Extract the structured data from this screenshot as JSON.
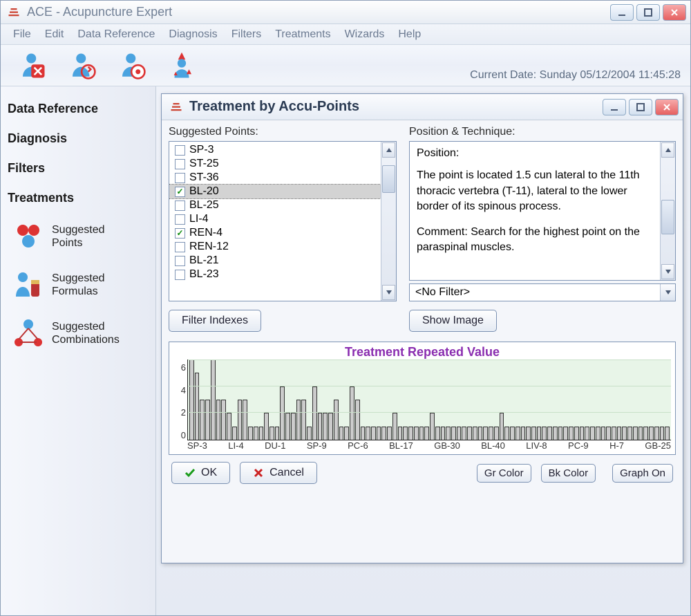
{
  "window": {
    "title": "ACE - Acupuncture Expert"
  },
  "menu": {
    "items": [
      "File",
      "Edit",
      "Data Reference",
      "Diagnosis",
      "Filters",
      "Treatments",
      "Wizards",
      "Help"
    ]
  },
  "status": {
    "current_date_label": "Current Date:",
    "current_date_value": "Sunday  05/12/2004  11:45:28"
  },
  "sidebar": {
    "headings": [
      "Data Reference",
      "Diagnosis",
      "Filters",
      "Treatments"
    ],
    "subitems": [
      {
        "line1": "Suggested",
        "line2": "Points"
      },
      {
        "line1": "Suggested",
        "line2": "Formulas"
      },
      {
        "line1": "Suggested",
        "line2": "Combinations"
      }
    ]
  },
  "child": {
    "title": "Treatment by Accu-Points",
    "suggested_label": "Suggested Points:",
    "position_label": "Position & Technique:",
    "points": [
      {
        "label": "SP-3",
        "checked": false
      },
      {
        "label": "ST-25",
        "checked": false
      },
      {
        "label": "ST-36",
        "checked": false
      },
      {
        "label": "BL-20",
        "checked": true,
        "selected": true
      },
      {
        "label": "BL-25",
        "checked": false
      },
      {
        "label": "LI-4",
        "checked": false
      },
      {
        "label": "REN-4",
        "checked": true
      },
      {
        "label": "REN-12",
        "checked": false
      },
      {
        "label": "BL-21",
        "checked": false
      },
      {
        "label": "BL-23",
        "checked": false
      }
    ],
    "detail": {
      "position_heading": "Position:",
      "position_text": "The point is located 1.5 cun lateral to the 11th thoracic vertebra (T-11), lateral to the lower border of its spinous process.",
      "comment_label": "Comment:",
      "comment_text": "Search for the highest point on the paraspinal muscles."
    },
    "filter_value": "<No Filter>",
    "filter_indexes_btn": "Filter Indexes",
    "show_image_btn": "Show Image",
    "buttons": {
      "ok": "OK",
      "cancel": "Cancel",
      "gr_color": "Gr Color",
      "bk_color": "Bk Color",
      "graph_on": "Graph On"
    }
  },
  "chart_data": {
    "type": "bar",
    "title": "Treatment Repeated Value",
    "ylabel": "",
    "xlabel": "",
    "ylim": [
      0,
      6
    ],
    "yticks": [
      0,
      2,
      4,
      6
    ],
    "xticks_shown": [
      "SP-3",
      "LI-4",
      "DU-1",
      "SP-9",
      "PC-6",
      "BL-17",
      "GB-30",
      "BL-40",
      "LIV-8",
      "PC-9",
      "H-7",
      "GB-25"
    ],
    "values": [
      6,
      5,
      3,
      3,
      6,
      3,
      3,
      2,
      1,
      3,
      3,
      1,
      1,
      1,
      2,
      1,
      1,
      4,
      2,
      2,
      3,
      3,
      1,
      4,
      2,
      2,
      2,
      3,
      1,
      1,
      4,
      3,
      1,
      1,
      1,
      1,
      1,
      1,
      2,
      1,
      1,
      1,
      1,
      1,
      1,
      2,
      1,
      1,
      1,
      1,
      1,
      1,
      1,
      1,
      1,
      1,
      1,
      1,
      2,
      1,
      1,
      1,
      1,
      1,
      1,
      1,
      1,
      1,
      1,
      1,
      1,
      1,
      1,
      1,
      1,
      1,
      1,
      1,
      1,
      1,
      1,
      1,
      1,
      1,
      1,
      1,
      1,
      1,
      1,
      1
    ]
  }
}
